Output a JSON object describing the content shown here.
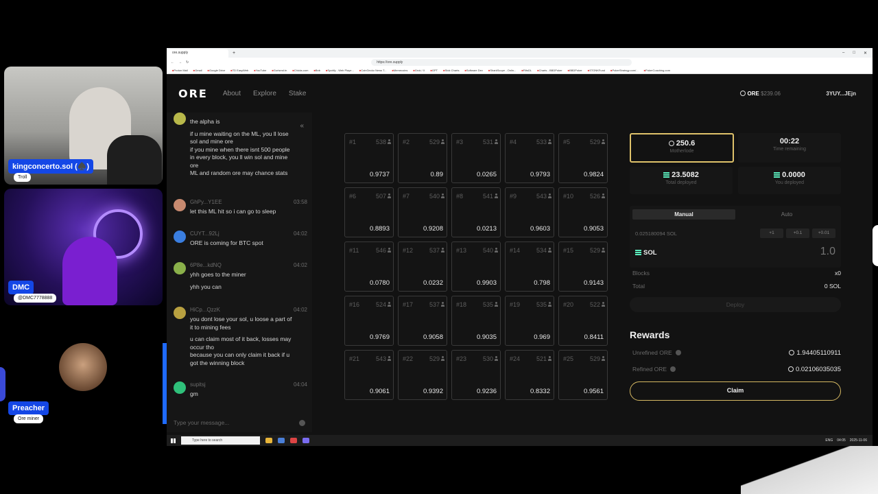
{
  "overlay": {
    "cams": [
      {
        "name": "kingconcerto.sol (♠️)",
        "role": "Troll"
      },
      {
        "name": "DMC",
        "role": "@DMC7778888"
      },
      {
        "name": "Preacher",
        "role": "Ore miner"
      }
    ]
  },
  "browser": {
    "tab_title": "ore.supply",
    "url": "https://ore.supply",
    "bookmarks": [
      "Proton Mail",
      "Gmail",
      "Google Drive",
      "TD EasyWeb",
      "YouTube",
      "Gorismd.tn",
      "Chicks.com",
      "Bnb",
      "Spotify - Web Playe...",
      "CoinGecko News T...",
      "Memecoins",
      "Grok / X",
      "GPT",
      "Stok Charts",
      "Software Dev",
      "SharkScope - Onlin...",
      "FiltsDL",
      "Charts - BBDPoker",
      "BBDPoker",
      "STONKFund",
      "PokerStrategy.com/...",
      "PokerCoaching.com"
    ]
  },
  "header": {
    "logo": "ORE",
    "nav": [
      "About",
      "Explore",
      "Stake"
    ],
    "ore_label": "ORE",
    "ore_price": "$239.06",
    "wallet": "3YUY...JEjn"
  },
  "chat": {
    "messages": [
      {
        "user": "",
        "time": "",
        "lines": [
          "the alpha is",
          "",
          "if u mine waiting on the ML, you ll lose",
          "sol and mine ore",
          "if you mine when there isnt 500 people",
          "in every block, you ll win sol and mine",
          "ore",
          "ML and random ore may chance stats"
        ]
      },
      {
        "user": "GhPy...Y1EE",
        "time": "03:58",
        "lines": [
          "let this ML hit so i can go to sleep"
        ]
      },
      {
        "user": "CUYT...92Lj",
        "time": "04:02",
        "lines": [
          "ORE is coming for BTC spot"
        ]
      },
      {
        "user": "6P8e...kdNQ",
        "time": "04:02",
        "lines": [
          "yhh goes to the miner",
          "",
          "yhh you can"
        ]
      },
      {
        "user": "HiCp...QzzK",
        "time": "04:02",
        "lines": [
          "you dont lose your sol, u loose a part of",
          "it to mining fees",
          "",
          "u can claim most of it back, losses may",
          "occur tho",
          "because you can only claim it back if u",
          "got the winning block"
        ]
      },
      {
        "user": "supitsj",
        "time": "04:04",
        "lines": [
          "gm"
        ]
      }
    ],
    "input_placeholder": "Type your message..."
  },
  "blocks": [
    {
      "id": "#1",
      "miners": "538",
      "value": "0.9737"
    },
    {
      "id": "#2",
      "miners": "529",
      "value": "0.89"
    },
    {
      "id": "#3",
      "miners": "531",
      "value": "0.0265"
    },
    {
      "id": "#4",
      "miners": "533",
      "value": "0.9793"
    },
    {
      "id": "#5",
      "miners": "529",
      "value": "0.9824"
    },
    {
      "id": "#6",
      "miners": "507",
      "value": "0.8893"
    },
    {
      "id": "#7",
      "miners": "540",
      "value": "0.9208"
    },
    {
      "id": "#8",
      "miners": "541",
      "value": "0.0213"
    },
    {
      "id": "#9",
      "miners": "543",
      "value": "0.9603"
    },
    {
      "id": "#10",
      "miners": "526",
      "value": "0.9053"
    },
    {
      "id": "#11",
      "miners": "546",
      "value": "0.0780"
    },
    {
      "id": "#12",
      "miners": "537",
      "value": "0.0232"
    },
    {
      "id": "#13",
      "miners": "540",
      "value": "0.9903"
    },
    {
      "id": "#14",
      "miners": "534",
      "value": "0.798"
    },
    {
      "id": "#15",
      "miners": "529",
      "value": "0.9143"
    },
    {
      "id": "#16",
      "miners": "524",
      "value": "0.9769"
    },
    {
      "id": "#17",
      "miners": "537",
      "value": "0.9058"
    },
    {
      "id": "#18",
      "miners": "535",
      "value": "0.9035"
    },
    {
      "id": "#19",
      "miners": "535",
      "value": "0.969"
    },
    {
      "id": "#20",
      "miners": "522",
      "value": "0.8411"
    },
    {
      "id": "#21",
      "miners": "543",
      "value": "0.9061"
    },
    {
      "id": "#22",
      "miners": "529",
      "value": "0.9392"
    },
    {
      "id": "#23",
      "miners": "530",
      "value": "0.9236"
    },
    {
      "id": "#24",
      "miners": "521",
      "value": "0.8332"
    },
    {
      "id": "#25",
      "miners": "529",
      "value": "0.9561"
    }
  ],
  "stats": {
    "motherlode": {
      "value": "250.6",
      "label": "Motherlode"
    },
    "time": {
      "value": "00:22",
      "label": "Time remaining"
    },
    "total_deployed": {
      "value": "23.5082",
      "label": "Total deployed"
    },
    "you_deployed": {
      "value": "0.0000",
      "label": "You deployed"
    }
  },
  "deploy": {
    "tabs": [
      "Manual",
      "Auto"
    ],
    "sol_amount": "0.025180094 SOL",
    "increments": [
      "+1",
      "+0.1",
      "+0.01"
    ],
    "token": "SOL",
    "amount_placeholder": "1.0",
    "blocks_label": "Blocks",
    "blocks_value": "x0",
    "total_label": "Total",
    "total_value": "0 SOL",
    "deploy_label": "Deploy"
  },
  "rewards": {
    "title": "Rewards",
    "unrefined_label": "Unrefined ORE",
    "unrefined_value": "1.94405110911",
    "refined_label": "Refined ORE",
    "refined_value": "0.02106035035",
    "claim_label": "Claim"
  },
  "taskbar": {
    "search_placeholder": "Type here to search",
    "lang": "ENG",
    "time": "04:05",
    "date": "2025-11-06"
  },
  "colors": {
    "accent_gold": "#e0c36b",
    "bg": "#121212",
    "name_plate": "#1447e6"
  }
}
